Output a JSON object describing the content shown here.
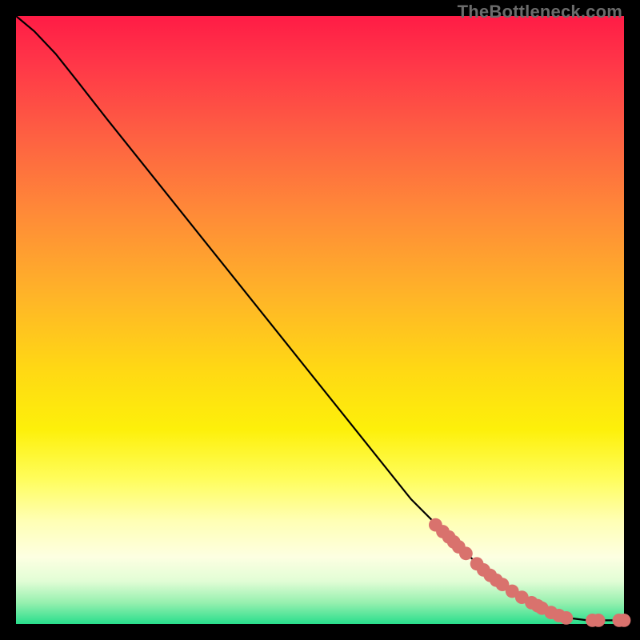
{
  "watermark": "TheBottleneck.com",
  "colors": {
    "dot": "#d9726d",
    "line": "#000000",
    "gradient_stops": [
      "#ff1c46",
      "#ff3748",
      "#fe6142",
      "#ff8c37",
      "#ffb428",
      "#ffd814",
      "#fdf00a",
      "#fffd5a",
      "#ffffb4",
      "#fdffe2",
      "#e1fdd5",
      "#96f0af",
      "#28de8c"
    ]
  },
  "chart_data": {
    "type": "line",
    "title": "",
    "xlabel": "",
    "ylabel": "",
    "xlim": [
      0,
      1
    ],
    "ylim": [
      0,
      1
    ],
    "curve": [
      {
        "x": 0.0,
        "y": 1.0
      },
      {
        "x": 0.03,
        "y": 0.975
      },
      {
        "x": 0.065,
        "y": 0.938
      },
      {
        "x": 0.1,
        "y": 0.894
      },
      {
        "x": 0.15,
        "y": 0.83
      },
      {
        "x": 0.25,
        "y": 0.705
      },
      {
        "x": 0.35,
        "y": 0.58
      },
      {
        "x": 0.45,
        "y": 0.455
      },
      {
        "x": 0.55,
        "y": 0.33
      },
      {
        "x": 0.65,
        "y": 0.205
      },
      {
        "x": 0.72,
        "y": 0.135
      },
      {
        "x": 0.78,
        "y": 0.08
      },
      {
        "x": 0.83,
        "y": 0.045
      },
      {
        "x": 0.87,
        "y": 0.024
      },
      {
        "x": 0.908,
        "y": 0.01
      },
      {
        "x": 0.94,
        "y": 0.006
      },
      {
        "x": 0.968,
        "y": 0.006
      },
      {
        "x": 0.99,
        "y": 0.006
      },
      {
        "x": 1.0,
        "y": 0.006
      }
    ],
    "points": [
      {
        "x": 0.69,
        "y": 0.163
      },
      {
        "x": 0.702,
        "y": 0.152
      },
      {
        "x": 0.712,
        "y": 0.143
      },
      {
        "x": 0.72,
        "y": 0.135
      },
      {
        "x": 0.728,
        "y": 0.127
      },
      {
        "x": 0.74,
        "y": 0.116
      },
      {
        "x": 0.758,
        "y": 0.099
      },
      {
        "x": 0.769,
        "y": 0.089
      },
      {
        "x": 0.78,
        "y": 0.08
      },
      {
        "x": 0.79,
        "y": 0.072
      },
      {
        "x": 0.8,
        "y": 0.065
      },
      {
        "x": 0.816,
        "y": 0.054
      },
      {
        "x": 0.832,
        "y": 0.044
      },
      {
        "x": 0.848,
        "y": 0.035
      },
      {
        "x": 0.858,
        "y": 0.03
      },
      {
        "x": 0.865,
        "y": 0.026
      },
      {
        "x": 0.88,
        "y": 0.019
      },
      {
        "x": 0.893,
        "y": 0.014
      },
      {
        "x": 0.905,
        "y": 0.01
      },
      {
        "x": 0.948,
        "y": 0.006
      },
      {
        "x": 0.958,
        "y": 0.006
      },
      {
        "x": 0.992,
        "y": 0.006
      },
      {
        "x": 1.0,
        "y": 0.006
      }
    ],
    "point_radius": 0.011
  }
}
